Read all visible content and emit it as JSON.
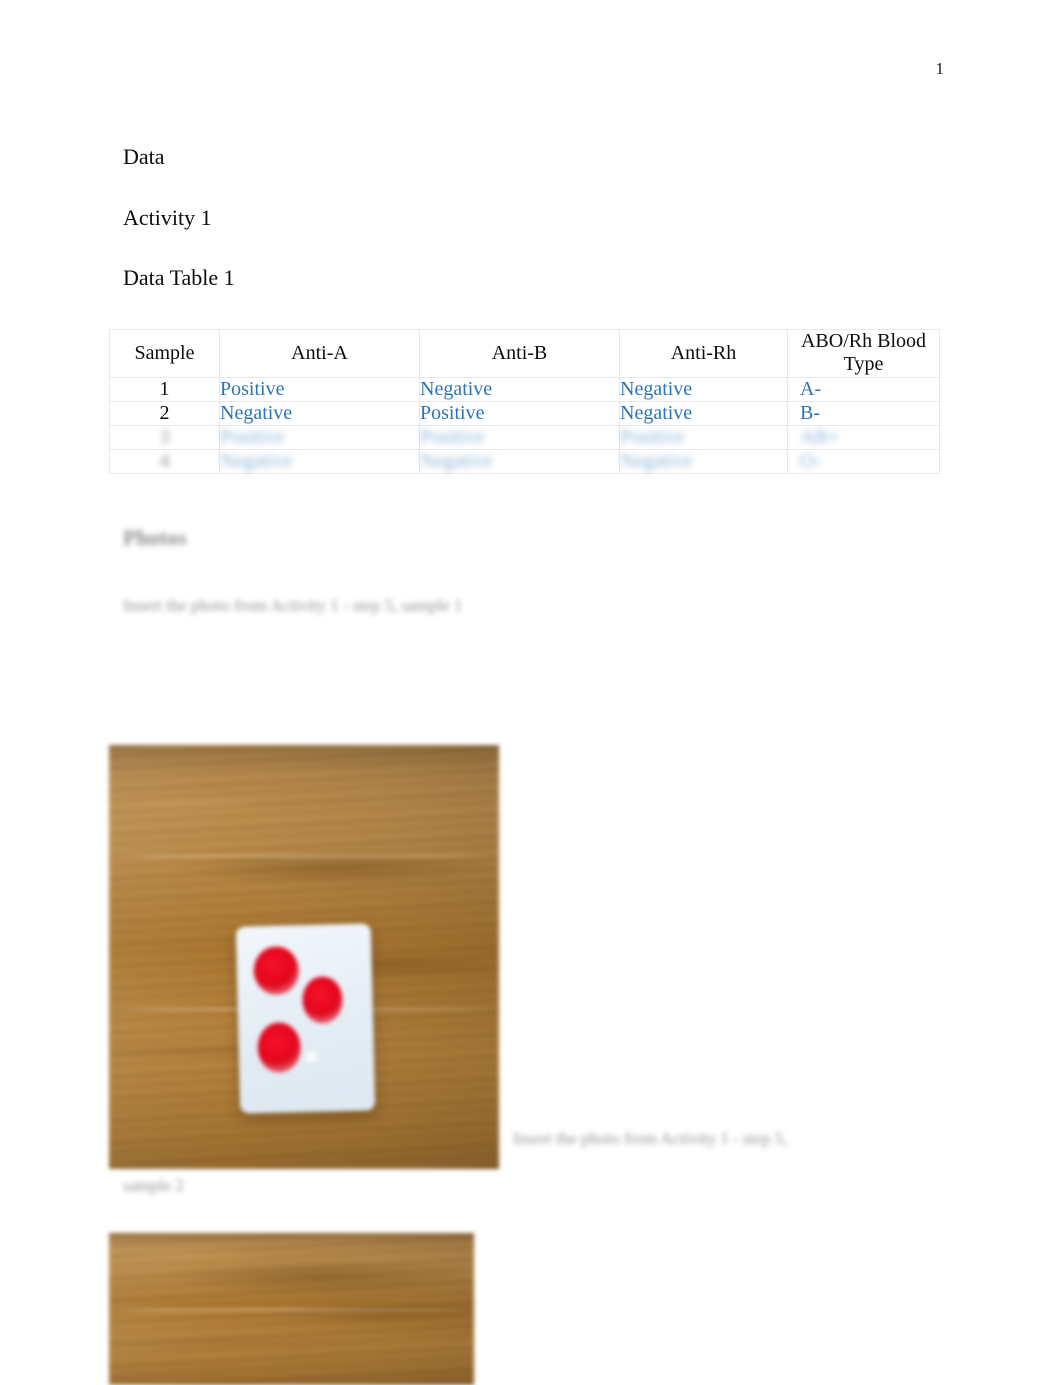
{
  "page": {
    "number": "1"
  },
  "headings": {
    "data": "Data",
    "activity": "Activity 1",
    "data_table": "Data Table 1",
    "photos": "Photos"
  },
  "table": {
    "columns": [
      "Sample",
      "Anti-A",
      "Anti-B",
      "Anti-Rh",
      "ABO/Rh Blood Type"
    ],
    "rows": [
      {
        "sample": "1",
        "anti_a": "Positive",
        "anti_b": "Negative",
        "anti_rh": "Negative",
        "blood_type": "A-",
        "legible": true
      },
      {
        "sample": "2",
        "anti_a": "Negative",
        "anti_b": "Positive",
        "anti_rh": "Negative",
        "blood_type": "B-",
        "legible": true
      },
      {
        "sample": "3",
        "anti_a": "Positive",
        "anti_b": "Positive",
        "anti_rh": "Positive",
        "blood_type": "AB+",
        "legible": false
      },
      {
        "sample": "4",
        "anti_a": "Negative",
        "anti_b": "Negative",
        "anti_rh": "Negative",
        "blood_type": "O-",
        "legible": false
      }
    ],
    "value_color": "#2e74b5",
    "gridline_color": "#e8e8e8"
  },
  "photos": {
    "caption_1": "Insert the photo from Activity 1 - step 5, sample 1",
    "caption_2": "Insert the photo from Activity 1 - step 5,",
    "caption_2_continued": "sample 2",
    "items": [
      {
        "alt": "Blood typing test card with three red blood drops on a wooden table",
        "wood_color": "#b08040",
        "card_color": "#e6eef6",
        "drop_color": "#e0081d"
      },
      {
        "alt": "Wooden table surface, photo cropped at page bottom",
        "wood_color": "#b08040"
      }
    ]
  }
}
